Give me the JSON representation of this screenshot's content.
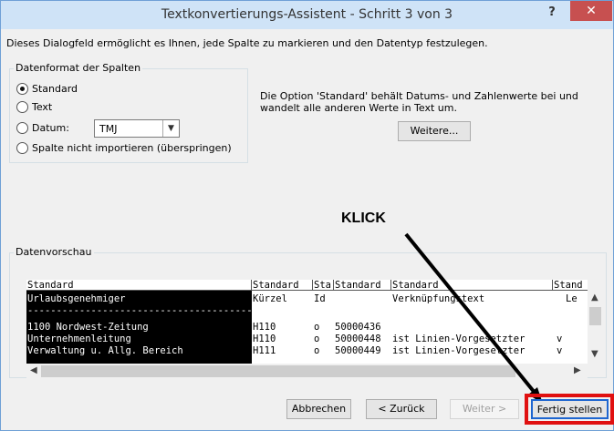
{
  "window": {
    "title": "Textkonvertierungs-Assistent - Schritt 3 von 3",
    "help_label": "?",
    "close_label": "✕"
  },
  "intro_text": "Dieses Dialogfeld ermöglicht es Ihnen, jede Spalte zu markieren und den Datentyp festzulegen.",
  "format_group": {
    "legend": "Datenformat der Spalten",
    "options": [
      {
        "label": "Standard",
        "checked": true
      },
      {
        "label": "Text",
        "checked": false
      },
      {
        "label": "Datum:",
        "checked": false
      },
      {
        "label": "Spalte nicht importieren (überspringen)",
        "checked": false
      }
    ],
    "date_format_value": "TMJ"
  },
  "description": "Die Option 'Standard' behält Datums- und Zahlenwerte bei und wandelt alle anderen Werte in Text um.",
  "weitere_label": "Weitere...",
  "annotation_text": "KLICK",
  "preview": {
    "legend": "Datenvorschau",
    "headers": [
      "Standard",
      "Standard",
      "Sta",
      "Standard",
      "Standard",
      "Stand"
    ],
    "rows": [
      [
        "Urlaubsgenehmiger",
        "Kürzel",
        "Id",
        "",
        "Verknüpfungstext",
        "Le"
      ],
      [
        "--------------------------------------------------",
        "",
        "",
        "",
        "",
        ""
      ],
      [
        "   1100 Nordwest-Zeitung",
        "H110",
        "o",
        "50000436",
        "",
        ""
      ],
      [
        "     Unternehmenleitung",
        "H110",
        "o",
        "50000448",
        "ist Linien-Vorgesetzter",
        "v"
      ],
      [
        "     Verwaltung u. Allg. Bereich",
        "H111",
        "o",
        "50000449",
        "ist Linien-Vorgesetzter",
        "v"
      ]
    ]
  },
  "buttons": {
    "abbrechen": "Abbrechen",
    "zurueck": "< Zurück",
    "weiter": "Weiter >",
    "fertig": "Fertig stellen"
  },
  "colors": {
    "title_bar": "#cfe3f7",
    "close_button": "#c75050",
    "highlight": "#e01010",
    "default_button_border": "#1e66d0"
  }
}
